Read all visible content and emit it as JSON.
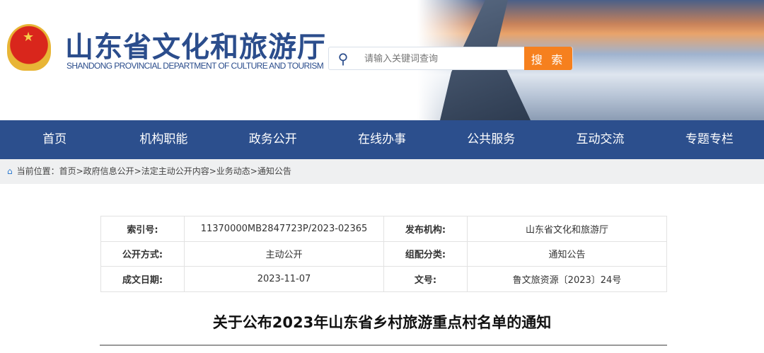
{
  "header": {
    "title": "山东省文化和旅游厅",
    "subtitle": "SHANDONG PROVINCIAL DEPARTMENT OF CULTURE AND TOURISM",
    "search_placeholder": "请输入关键词查询",
    "search_button": "搜 索"
  },
  "nav": [
    "首页",
    "机构职能",
    "政务公开",
    "在线办事",
    "公共服务",
    "互动交流",
    "专题专栏"
  ],
  "breadcrumb": "当前位置：首页>政府信息公开>法定主动公开内容>业务动态>通知公告",
  "meta": [
    [
      {
        "k": "索引号:",
        "v": "11370000MB2847723P/2023-02365"
      },
      {
        "k": "发布机构:",
        "v": "山东省文化和旅游厅"
      }
    ],
    [
      {
        "k": "公开方式:",
        "v": "主动公开"
      },
      {
        "k": "组配分类:",
        "v": "通知公告"
      }
    ],
    [
      {
        "k": "成文日期:",
        "v": "2023-11-07"
      },
      {
        "k": "文号:",
        "v": "鲁文旅资源〔2023〕24号"
      }
    ]
  ],
  "article_title": "关于公布2023年山东省乡村旅游重点村名单的通知"
}
